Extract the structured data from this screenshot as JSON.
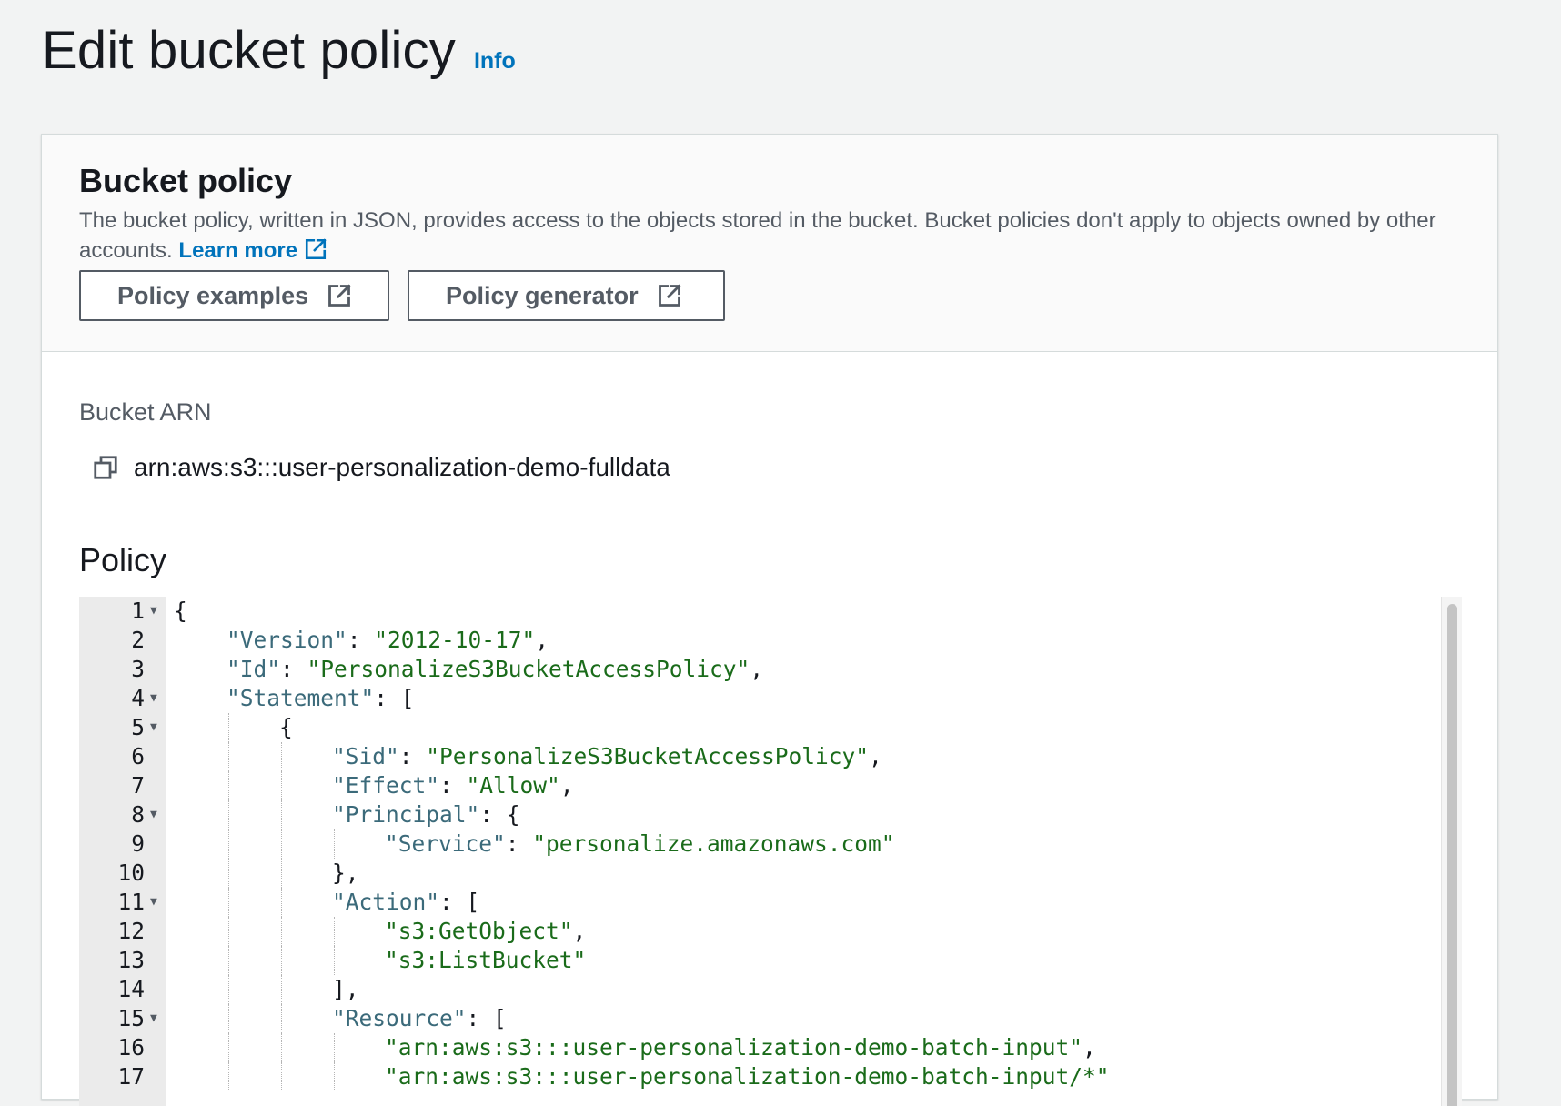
{
  "page": {
    "title": "Edit bucket policy",
    "info_link": "Info"
  },
  "bucket_policy": {
    "title": "Bucket policy",
    "description": "The bucket policy, written in JSON, provides access to the objects stored in the bucket. Bucket policies don't apply to objects owned by other accounts.",
    "learn_more": "Learn more",
    "buttons": {
      "policy_examples": "Policy examples",
      "policy_generator": "Policy generator"
    },
    "icons": {
      "external_link": "external-link-icon",
      "copy": "copy-icon"
    }
  },
  "bucket_arn": {
    "label": "Bucket ARN",
    "value": "arn:aws:s3:::user-personalization-demo-fulldata"
  },
  "policy": {
    "label": "Policy",
    "lines": [
      {
        "num": "1",
        "fold": true,
        "indent": 0,
        "tokens": [
          {
            "t": "p",
            "v": "{"
          }
        ]
      },
      {
        "num": "2",
        "fold": false,
        "indent": 1,
        "tokens": [
          {
            "t": "k",
            "v": "\"Version\""
          },
          {
            "t": "p",
            "v": ": "
          },
          {
            "t": "s",
            "v": "\"2012-10-17\""
          },
          {
            "t": "p",
            "v": ","
          }
        ]
      },
      {
        "num": "3",
        "fold": false,
        "indent": 1,
        "tokens": [
          {
            "t": "k",
            "v": "\"Id\""
          },
          {
            "t": "p",
            "v": ": "
          },
          {
            "t": "s",
            "v": "\"PersonalizeS3BucketAccessPolicy\""
          },
          {
            "t": "p",
            "v": ","
          }
        ]
      },
      {
        "num": "4",
        "fold": true,
        "indent": 1,
        "tokens": [
          {
            "t": "k",
            "v": "\"Statement\""
          },
          {
            "t": "p",
            "v": ": ["
          }
        ]
      },
      {
        "num": "5",
        "fold": true,
        "indent": 2,
        "tokens": [
          {
            "t": "p",
            "v": "{"
          }
        ]
      },
      {
        "num": "6",
        "fold": false,
        "indent": 3,
        "tokens": [
          {
            "t": "k",
            "v": "\"Sid\""
          },
          {
            "t": "p",
            "v": ": "
          },
          {
            "t": "s",
            "v": "\"PersonalizeS3BucketAccessPolicy\""
          },
          {
            "t": "p",
            "v": ","
          }
        ]
      },
      {
        "num": "7",
        "fold": false,
        "indent": 3,
        "tokens": [
          {
            "t": "k",
            "v": "\"Effect\""
          },
          {
            "t": "p",
            "v": ": "
          },
          {
            "t": "s",
            "v": "\"Allow\""
          },
          {
            "t": "p",
            "v": ","
          }
        ]
      },
      {
        "num": "8",
        "fold": true,
        "indent": 3,
        "tokens": [
          {
            "t": "k",
            "v": "\"Principal\""
          },
          {
            "t": "p",
            "v": ": {"
          }
        ]
      },
      {
        "num": "9",
        "fold": false,
        "indent": 4,
        "tokens": [
          {
            "t": "k",
            "v": "\"Service\""
          },
          {
            "t": "p",
            "v": ": "
          },
          {
            "t": "s",
            "v": "\"personalize.amazonaws.com\""
          }
        ]
      },
      {
        "num": "10",
        "fold": false,
        "indent": 3,
        "tokens": [
          {
            "t": "p",
            "v": "},"
          }
        ]
      },
      {
        "num": "11",
        "fold": true,
        "indent": 3,
        "tokens": [
          {
            "t": "k",
            "v": "\"Action\""
          },
          {
            "t": "p",
            "v": ": ["
          }
        ]
      },
      {
        "num": "12",
        "fold": false,
        "indent": 4,
        "tokens": [
          {
            "t": "s",
            "v": "\"s3:GetObject\""
          },
          {
            "t": "p",
            "v": ","
          }
        ]
      },
      {
        "num": "13",
        "fold": false,
        "indent": 4,
        "tokens": [
          {
            "t": "s",
            "v": "\"s3:ListBucket\""
          }
        ]
      },
      {
        "num": "14",
        "fold": false,
        "indent": 3,
        "tokens": [
          {
            "t": "p",
            "v": "],"
          }
        ]
      },
      {
        "num": "15",
        "fold": true,
        "indent": 3,
        "tokens": [
          {
            "t": "k",
            "v": "\"Resource\""
          },
          {
            "t": "p",
            "v": ": ["
          }
        ]
      },
      {
        "num": "16",
        "fold": false,
        "indent": 4,
        "tokens": [
          {
            "t": "s",
            "v": "\"arn:aws:s3:::user-personalization-demo-batch-input\""
          },
          {
            "t": "p",
            "v": ","
          }
        ]
      },
      {
        "num": "17",
        "fold": false,
        "indent": 4,
        "tokens": [
          {
            "t": "s",
            "v": "\"arn:aws:s3:::user-personalization-demo-batch-input/*\""
          }
        ]
      }
    ]
  }
}
